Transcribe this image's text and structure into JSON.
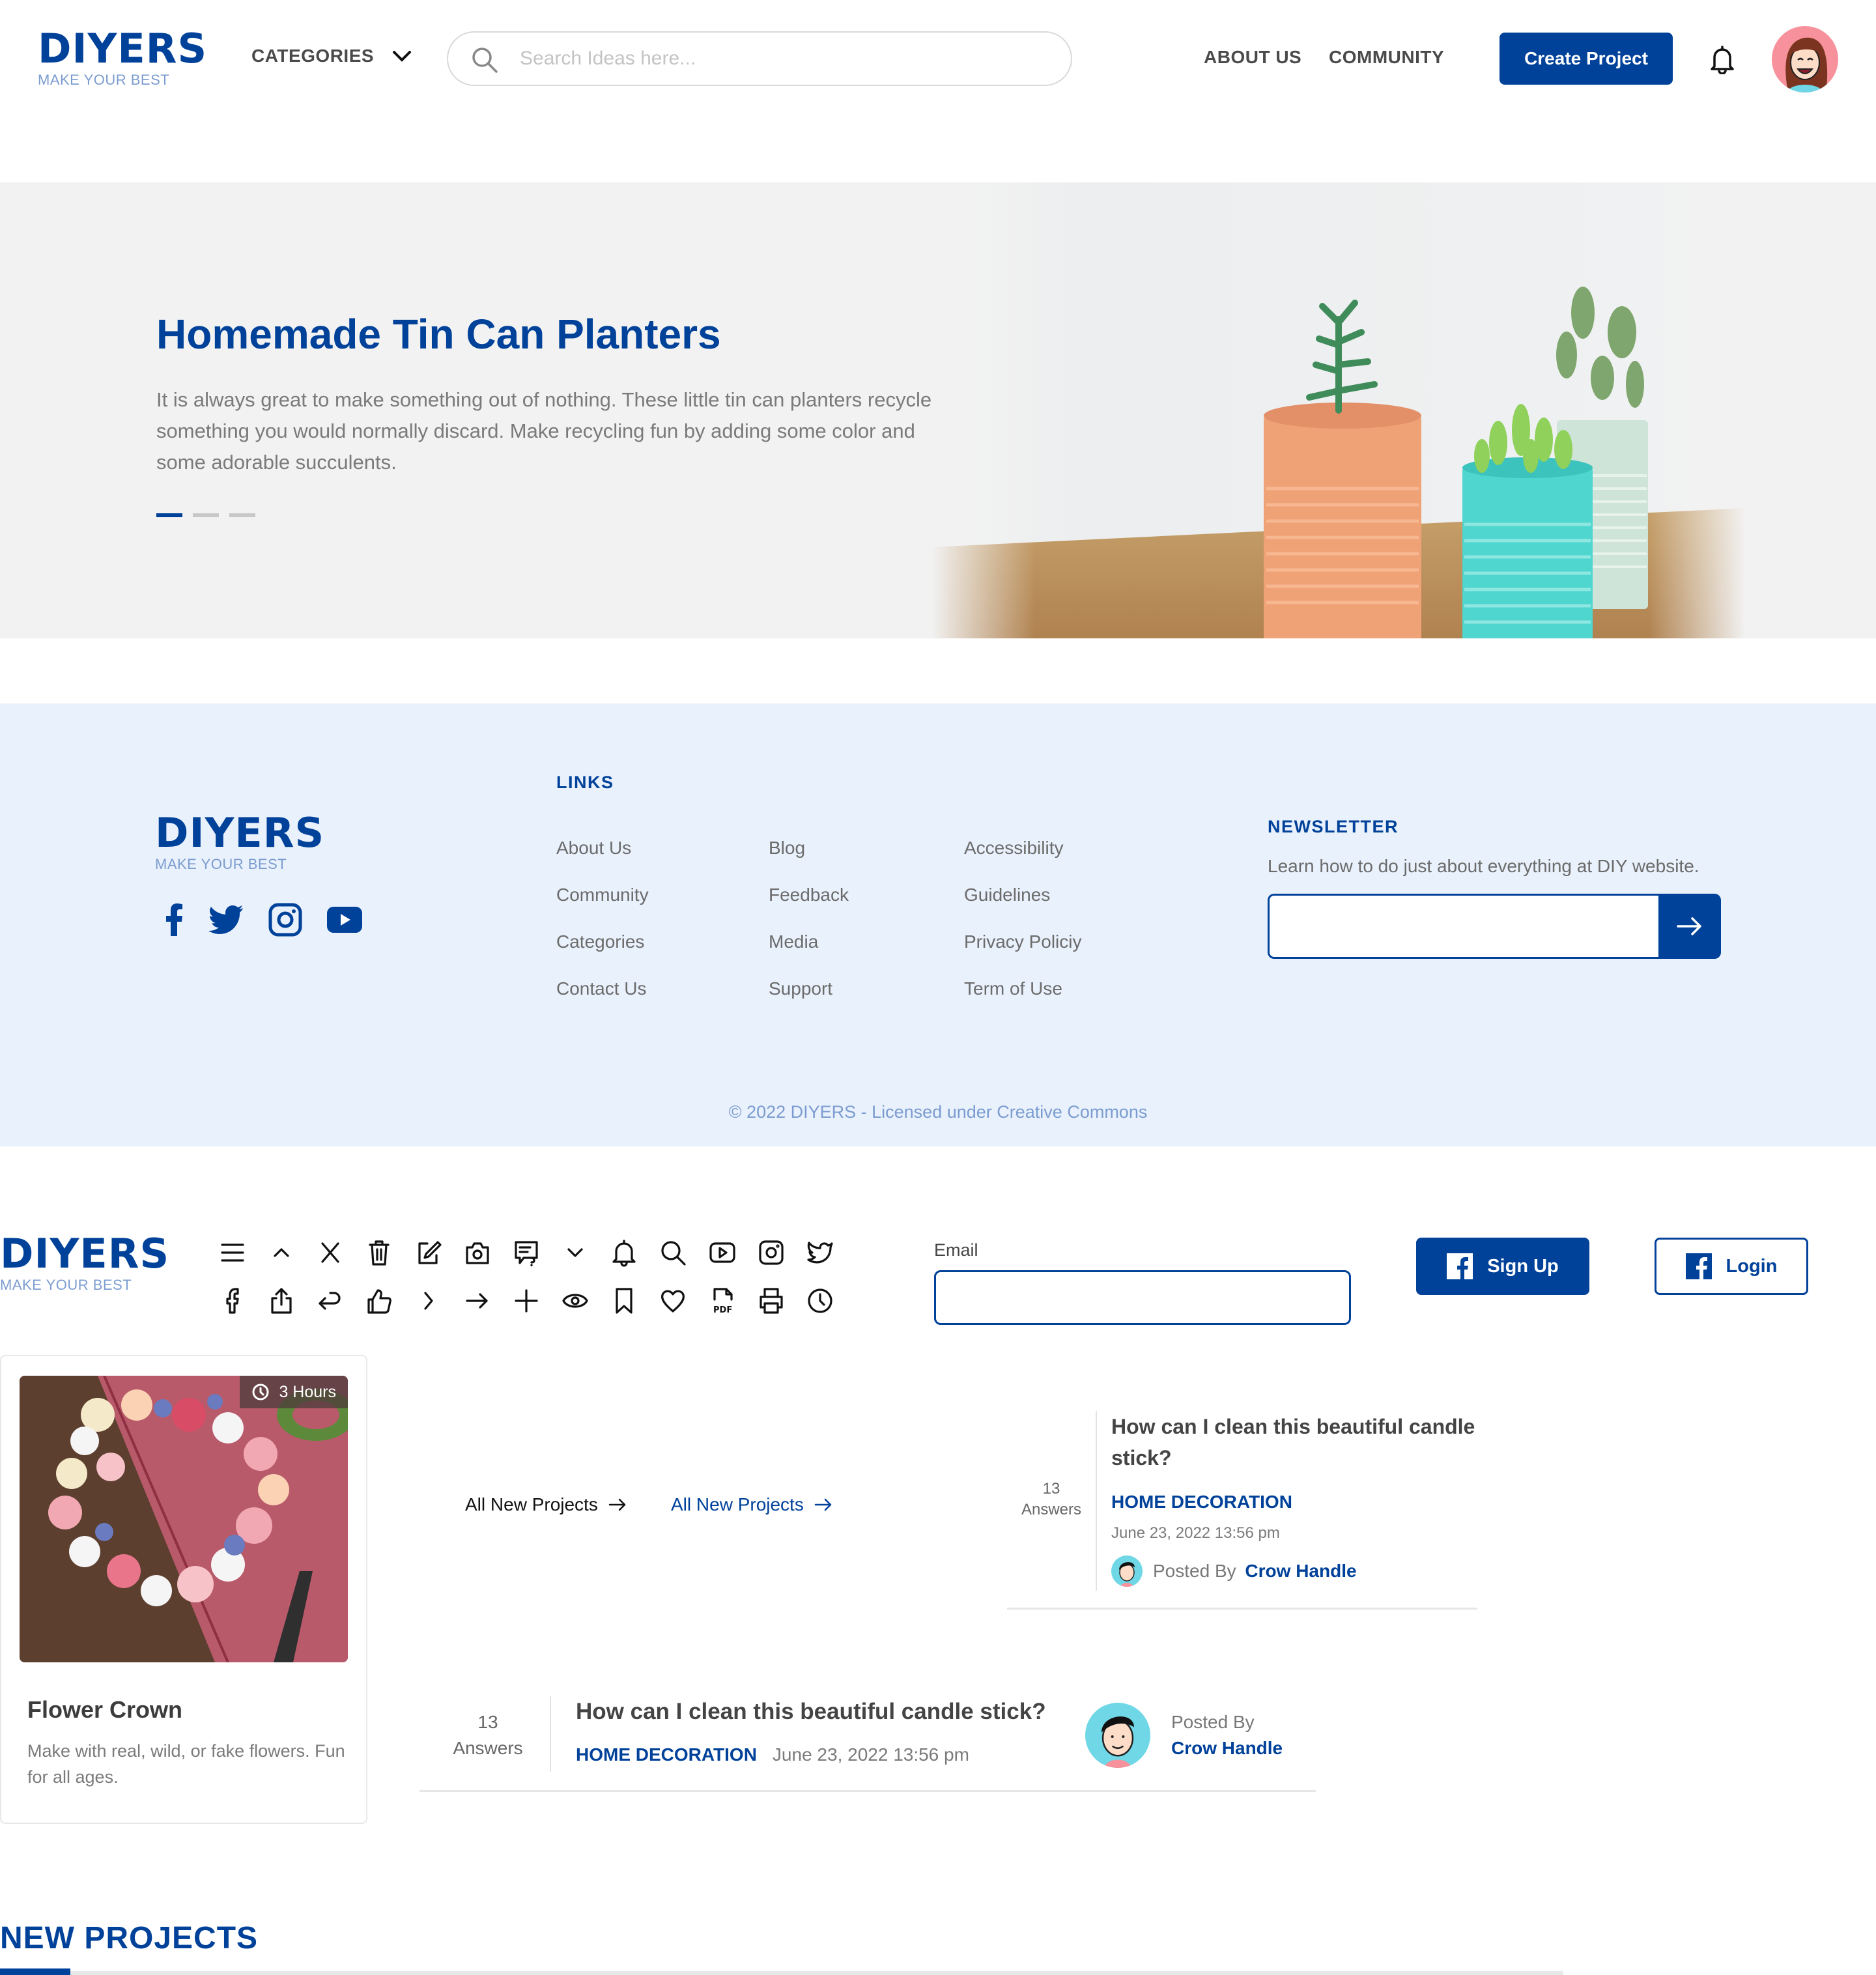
{
  "header": {
    "logo": {
      "word": "DIYERS",
      "tagline": "MAKE YOUR BEST"
    },
    "categories_label": "CATEGORIES",
    "search_placeholder": "Search Ideas here...",
    "nav": [
      "ABOUT US",
      "COMMUNITY"
    ],
    "create_button": "Create Project",
    "icons": {
      "search": "search-icon",
      "chevron": "chevron-down-icon",
      "bell": "bell-icon",
      "avatar": "user-avatar"
    }
  },
  "hero": {
    "title": "Homemade Tin Can Planters",
    "description": "It is always great to make something out of nothing. These little tin can planters recycle something you would normally discard. Make recycling fun by adding some color and some adorable succulents.",
    "slides_total": 3,
    "active_slide": 1
  },
  "footer": {
    "logo": {
      "word": "DIYERS",
      "tagline": "MAKE YOUR BEST"
    },
    "social_icons": [
      "facebook-icon",
      "twitter-icon",
      "instagram-icon",
      "youtube-icon"
    ],
    "links_heading": "LINKS",
    "links": [
      [
        "About Us",
        "Community",
        "Categories",
        "Contact Us"
      ],
      [
        "Blog",
        "Feedback",
        "Media",
        "Support"
      ],
      [
        "Accessibility",
        "Guidelines",
        "Privacy Policiy",
        "Term of Use"
      ]
    ],
    "newsletter": {
      "heading": "NEWSLETTER",
      "text": "Learn how to do just about everything at DIY website.",
      "input_value": "",
      "submit_icon": "arrow-right-icon"
    },
    "copyright": "© 2022 DIYERS - Licensed under Creative Commons"
  },
  "components": {
    "logo": {
      "word": "DIYERS",
      "tagline": "MAKE YOUR BEST"
    },
    "icon_rows": [
      [
        "menu-icon",
        "chevron-up-icon",
        "close-icon",
        "trash-icon",
        "edit-icon",
        "camera-icon",
        "comment-question-icon",
        "chevron-down-icon",
        "bell-icon",
        "search-icon",
        "youtube-icon",
        "instagram-icon",
        "twitter-icon"
      ],
      [
        "facebook-icon",
        "share-icon",
        "reply-icon",
        "thumbs-up-icon",
        "chevron-right-icon",
        "arrow-right-icon",
        "plus-icon",
        "eye-icon",
        "bookmark-icon",
        "heart-icon",
        "pdf-icon",
        "print-icon",
        "clock-icon"
      ]
    ],
    "email_label": "Email",
    "email_value": "",
    "signup_button": "Sign Up",
    "login_button": "Login"
  },
  "project_card": {
    "duration": "3 Hours",
    "title": "Flower Crown",
    "description": "Make with real, wild, or fake flowers. Fun for all ages."
  },
  "links": {
    "all_projects_dark": "All New Projects",
    "all_projects_blue": "All New Projects"
  },
  "question_vertical": {
    "answers_count": "13",
    "answers_label": "Answers",
    "title": "How can I clean this beautiful candle stick?",
    "category": "HOME DECORATION",
    "date": "June 23, 2022 13:56 pm",
    "posted_by_label": "Posted By",
    "author": "Crow Handle"
  },
  "question_horizontal": {
    "answers_count": "13",
    "answers_label": "Answers",
    "title": "How can I clean this beautiful candle stick?",
    "category": "HOME DECORATION",
    "date": "June 23, 2022 13:56 pm",
    "posted_by_label": "Posted By",
    "author": "Crow Handle"
  },
  "section": {
    "title": "NEW PROJECTS"
  },
  "colors": {
    "brand": "#00419a",
    "footer_bg": "#e9f1fc",
    "hero_bg": "#f2f2f2",
    "tagline": "#7b9cd0"
  }
}
